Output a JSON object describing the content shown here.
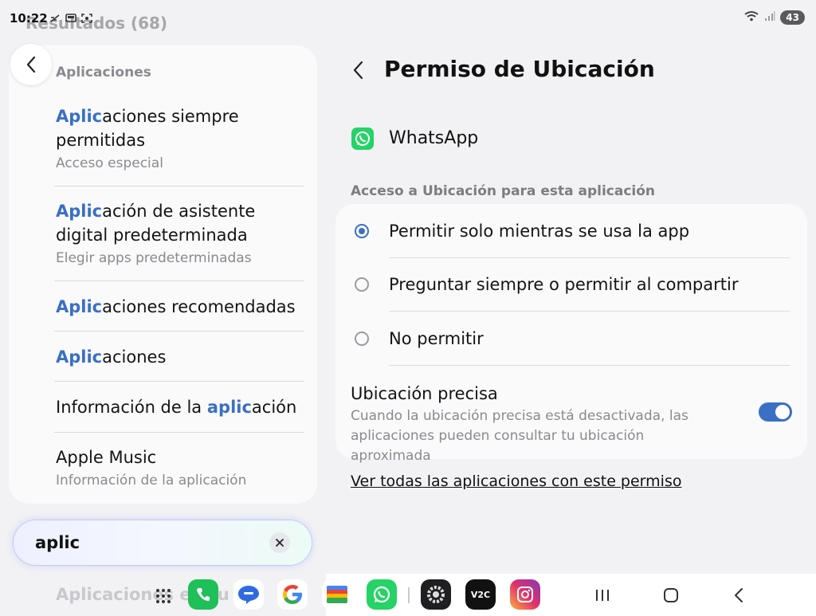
{
  "status_bar": {
    "time": "10:22",
    "battery": "43"
  },
  "left_pane": {
    "results_header": "Resultados (68)",
    "section_label": "Aplicaciones",
    "results": [
      {
        "highlight": "Aplic",
        "rest": "aciones siempre permitidas",
        "sub": "Acceso especial"
      },
      {
        "highlight": "Aplic",
        "rest": "ación de asistente digital predeterminada",
        "sub": "Elegir apps predeterminadas"
      },
      {
        "highlight": "Aplic",
        "rest": "aciones recomendadas",
        "sub": ""
      },
      {
        "highlight": "Aplic",
        "rest": "aciones",
        "sub": ""
      },
      {
        "prefix": "Información de la ",
        "highlight": "aplic",
        "rest": "ación",
        "sub": ""
      },
      {
        "title": "Apple Music",
        "sub": "Información de la aplicación"
      }
    ],
    "search": {
      "value": "aplic"
    },
    "ghost_row": "Aplicaciones exclu"
  },
  "right_pane": {
    "title": "Permiso de Ubicación",
    "app_name": "WhatsApp",
    "access_label": "Acceso a Ubicación para esta aplicación",
    "options": [
      {
        "label": "Permitir solo mientras se usa la app",
        "selected": true
      },
      {
        "label": "Preguntar siempre o permitir al compartir",
        "selected": false
      },
      {
        "label": "No permitir",
        "selected": false
      }
    ],
    "precise": {
      "title": "Ubicación precisa",
      "description": "Cuando la ubicación precisa está desactivada, las aplicaciones pueden consultar tu ubicación aproximada",
      "enabled": true
    },
    "see_all_link": "Ver todas las aplicaciones con este permiso"
  },
  "taskbar": {
    "apps": [
      "phone-icon",
      "messages-icon",
      "google-icon",
      "wallet-icon",
      "whatsapp-icon",
      "settings-icon",
      "v2c-icon",
      "instagram-icon"
    ],
    "v2c_label": "V2C"
  },
  "colors": {
    "accent": "#3a6fc4",
    "whatsapp": "#25d366"
  }
}
